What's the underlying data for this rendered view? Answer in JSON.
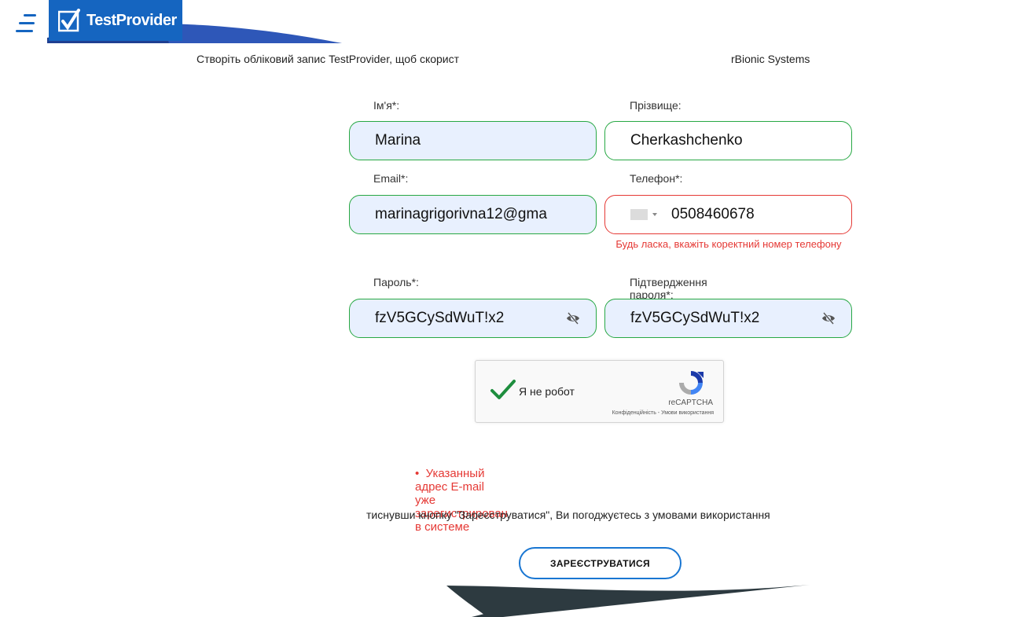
{
  "header": {
    "logo_text": "TestProvider",
    "menu_icon": "menu-icon",
    "logo_icon": "checkmark-logo-icon",
    "brand_color": "#1565c0"
  },
  "intro": {
    "left_text": "Створіть обліковий запис TestProvider, щоб скорист",
    "right_text": "rBionic Systems"
  },
  "form": {
    "first_name": {
      "label": "Ім'я*:",
      "value": "Marina"
    },
    "last_name": {
      "label": "Прізвище:",
      "value": "Cherkashchenko"
    },
    "email": {
      "label": "Email*:",
      "value": "marinagrigorivna12@gma"
    },
    "phone": {
      "label": "Телефон*:",
      "value": "0508460678",
      "error": "Будь ласка, вкажіть коректний номер телефону"
    },
    "password": {
      "label": "Пароль*:",
      "value": "fzV5GCySdWuT!x2",
      "toggle_icon": "eye-off-icon"
    },
    "password_confirm": {
      "label": "Підтвердження пароля*:",
      "value": "fzV5GCySdWuT!x2",
      "toggle_icon": "eye-off-icon"
    }
  },
  "captcha": {
    "label": "Я не робот",
    "brand": "reCAPTCHA",
    "links": "Конфіденційність - Умови використання",
    "checked": true
  },
  "server_error": "Указанный адрес E-mail уже зарегистрирован в системе",
  "terms_text": "тиснувши кнопку \"Зареєструватися\", Ви погоджуєтесь з умовами використання",
  "submit_label": "ЗАРЕЄСТРУВАТИСЯ",
  "colors": {
    "valid_border": "#27a844",
    "error": "#e53935",
    "button_border": "#1976d2",
    "dark_shape": "#2d3a40"
  }
}
